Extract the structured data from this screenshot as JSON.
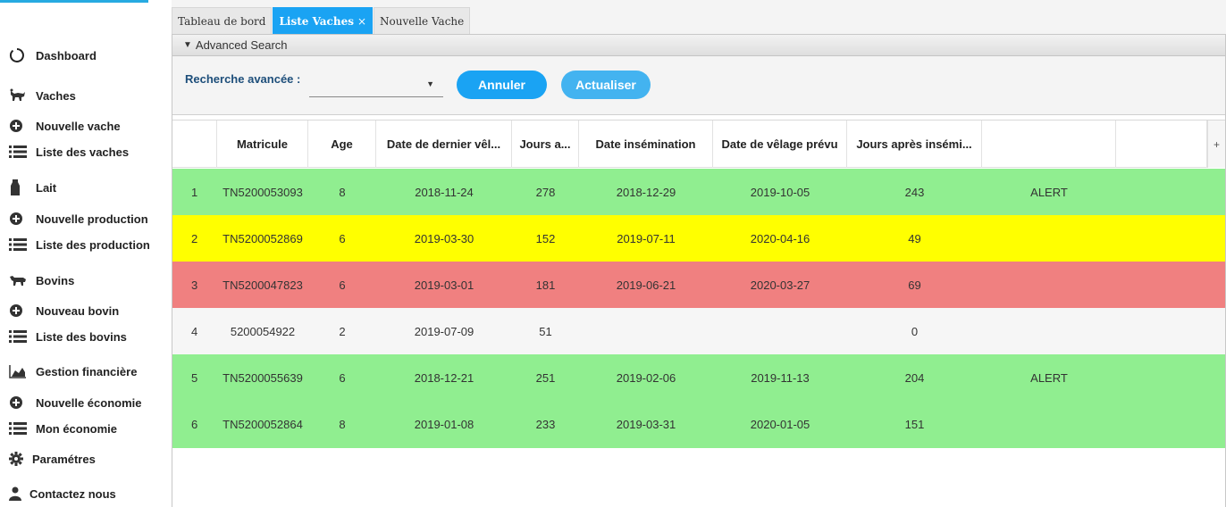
{
  "sidebar": {
    "items": [
      {
        "label": "Dashboard",
        "icon": "circle-outline-icon"
      },
      {
        "label": "Vaches",
        "icon": "cow-icon"
      },
      {
        "label": "Nouvelle vache",
        "icon": "plus-circle-icon"
      },
      {
        "label": "Liste des vaches",
        "icon": "list-icon"
      },
      {
        "label": "Lait",
        "icon": "milk-bottle-icon"
      },
      {
        "label": "Nouvelle production",
        "icon": "plus-circle-icon"
      },
      {
        "label": "Liste des production",
        "icon": "list-icon"
      },
      {
        "label": "Bovins",
        "icon": "bovine-icon"
      },
      {
        "label": "Nouveau bovin",
        "icon": "plus-circle-icon"
      },
      {
        "label": "Liste des bovins",
        "icon": "list-icon"
      },
      {
        "label": "Gestion financière",
        "icon": "area-chart-icon"
      },
      {
        "label": "Nouvelle économie",
        "icon": "plus-circle-icon"
      },
      {
        "label": "Mon économie",
        "icon": "list-icon"
      },
      {
        "label": "Paramétres",
        "icon": "gear-icon"
      },
      {
        "label": "Contactez nous",
        "icon": "user-icon"
      }
    ]
  },
  "tabs": [
    {
      "label": "Tableau de bord",
      "active": false
    },
    {
      "label": "Liste Vaches",
      "active": true,
      "close": "×"
    },
    {
      "label": "Nouvelle Vache",
      "active": false
    }
  ],
  "search": {
    "header": "Advanced Search",
    "label": "Recherche avancée :",
    "combo_value": "",
    "annuler": "Annuler",
    "actualiser": "Actualiser"
  },
  "table": {
    "columns": [
      "",
      "Matricule",
      "Age",
      "Date de dernier vêl...",
      "Jours a...",
      "Date insémination",
      "Date de vêlage prévu",
      "Jours après insémi...",
      "",
      ""
    ],
    "plus": "+",
    "rows": [
      {
        "color": "green",
        "cells": [
          "1",
          "TN5200053093",
          "8",
          "2018-11-24",
          "278",
          "2018-12-29",
          "2019-10-05",
          "243",
          "ALERT",
          ""
        ]
      },
      {
        "color": "yellow",
        "cells": [
          "2",
          "TN5200052869",
          "6",
          "2019-03-30",
          "152",
          "2019-07-11",
          "2020-04-16",
          "49",
          "",
          ""
        ]
      },
      {
        "color": "red",
        "cells": [
          "3",
          "TN5200047823",
          "6",
          "2019-03-01",
          "181",
          "2019-06-21",
          "2020-03-27",
          "69",
          "",
          ""
        ]
      },
      {
        "color": "plain",
        "cells": [
          "4",
          "5200054922",
          "2",
          "2019-07-09",
          "51",
          "",
          "",
          "0",
          "",
          ""
        ]
      },
      {
        "color": "green",
        "cells": [
          "5",
          "TN5200055639",
          "6",
          "2018-12-21",
          "251",
          "2019-02-06",
          "2019-11-13",
          "204",
          "ALERT",
          ""
        ]
      },
      {
        "color": "green",
        "cells": [
          "6",
          "TN5200052864",
          "8",
          "2019-01-08",
          "233",
          "2019-03-31",
          "2020-01-05",
          "151",
          "",
          ""
        ]
      }
    ]
  },
  "colors": {
    "accent": "#1aa3f3",
    "row_green": "#90ee90",
    "row_yellow": "#ffff00",
    "row_red": "#f08080"
  }
}
